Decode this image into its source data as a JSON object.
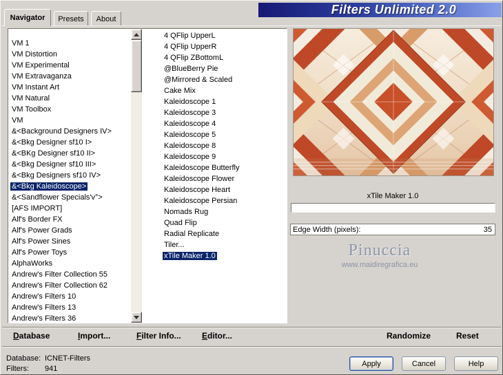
{
  "window": {
    "title": "Filters Unlimited 2.0"
  },
  "tabs": {
    "items": [
      {
        "label": "Navigator",
        "active": true
      },
      {
        "label": "Presets",
        "active": false
      },
      {
        "label": "About",
        "active": false
      }
    ]
  },
  "category_list": {
    "items": [
      "VM 1",
      "VM Distortion",
      "VM Experimental",
      "VM Extravaganza",
      "VM Instant Art",
      "VM Natural",
      "VM Toolbox",
      "VM",
      "&<Background Designers IV>",
      "&<Bkg Designer sf10 I>",
      "&<BKg Designer sf10 II>",
      "&<Bkg Designer sf10 III>",
      "&<Bkg Designers sf10 IV>",
      "&<Bkg Kaleidoscope>",
      "&<Sandflower Specials'v°>",
      "[AFS IMPORT]",
      "Alf's Border FX",
      "Alf's Power Grads",
      "Alf's Power Sines",
      "Alf's Power Toys",
      "AlphaWorks",
      "Andrew's Filter Collection 55",
      "Andrew's Filter Collection 62",
      "Andrew's Filters 10",
      "Andrew's Filters 13",
      "Andrew's Filters 36"
    ],
    "selected_index": 13
  },
  "filter_list": {
    "items": [
      "4 QFlip UpperL",
      "4 QFlip UpperR",
      "4 QFlip ZBottomL",
      "@BlueBerry Pie",
      "@Mirrored & Scaled",
      "Cake Mix",
      "Kaleidoscope 1",
      "Kaleidoscope 3",
      "Kaleidoscope 4",
      "Kaleidoscope 5",
      "Kaleidoscope 8",
      "Kaleidoscope 9",
      "Kaleidoscope Butterfly",
      "Kaleidoscope Flower",
      "Kaleidoscope Heart",
      "Kaleidoscope Persian",
      "Nomads Rug",
      "Quad Flip",
      "Radial Replicate",
      "Tiler...",
      "xTile Maker 1.0"
    ],
    "selected_index": 20
  },
  "preview": {
    "filter_name": "xTile Maker 1.0"
  },
  "parameter": {
    "label": "Edge Width (pixels):",
    "value": "35"
  },
  "watermark": {
    "line1": "Pinuccia",
    "line2": "www.maidiregrafica.eu"
  },
  "toolbar": {
    "database": "Database",
    "import": "Import...",
    "filter_info": "Filter Info...",
    "editor": "Editor...",
    "randomize": "Randomize",
    "reset": "Reset"
  },
  "status": {
    "database_label": "Database:",
    "database_value": "ICNET-Filters",
    "filters_label": "Filters:",
    "filters_value": "941"
  },
  "action_buttons": {
    "apply": "Apply",
    "cancel": "Cancel",
    "help": "Help"
  },
  "colors": {
    "selection": "#0a246a",
    "dialog_bg": "#d6d3ce",
    "title_gradient_start": "#161a74",
    "title_gradient_end": "#8aa0e8"
  }
}
